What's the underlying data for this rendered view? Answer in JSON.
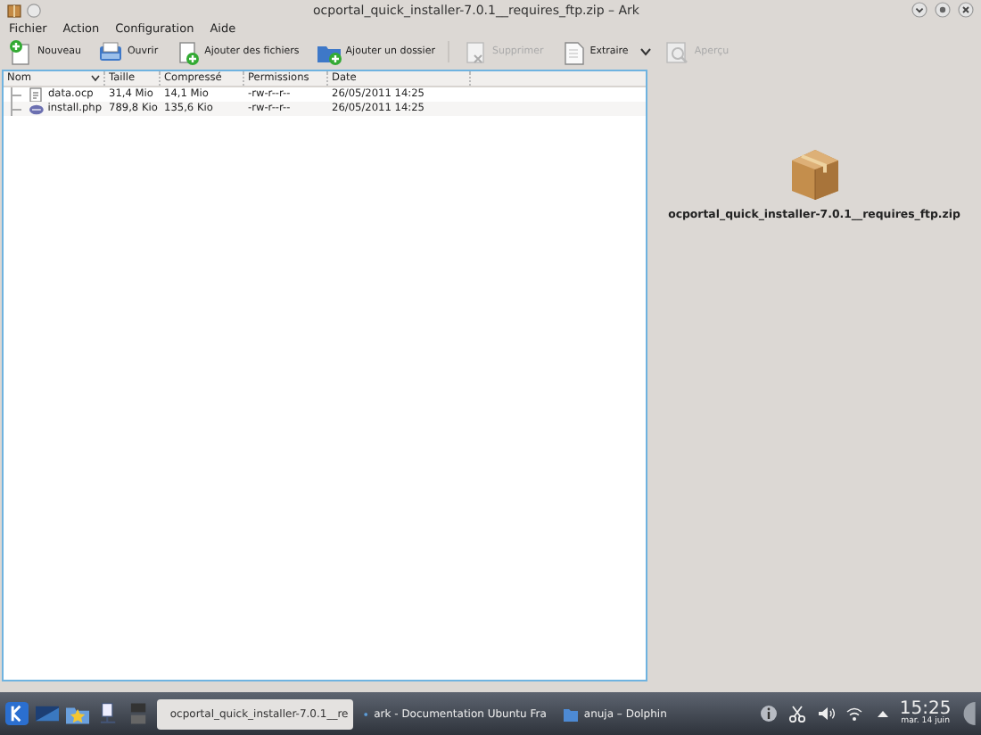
{
  "window": {
    "title": "ocportal_quick_installer-7.0.1__requires_ftp.zip – Ark"
  },
  "menu": [
    {
      "label": "Fichier"
    },
    {
      "label": "Action"
    },
    {
      "label": "Configuration"
    },
    {
      "label": "Aide"
    }
  ],
  "toolbar": [
    {
      "kind": "new",
      "label": "Nouveau",
      "disabled": false
    },
    {
      "kind": "open",
      "label": "Ouvrir",
      "disabled": false
    },
    {
      "kind": "add-files",
      "label": "Ajouter des fichiers",
      "disabled": false
    },
    {
      "kind": "add-folder",
      "label": "Ajouter un dossier",
      "disabled": false
    },
    {
      "kind": "delete",
      "label": "Supprimer",
      "disabled": true
    },
    {
      "kind": "extract",
      "label": "Extraire",
      "disabled": false
    },
    {
      "kind": "preview",
      "label": "Aperçu",
      "disabled": true
    }
  ],
  "file_list": {
    "columns": [
      {
        "label": "Nom",
        "sorted": true
      },
      {
        "label": "Taille",
        "sorted": false
      },
      {
        "label": "Compressé",
        "sorted": false
      },
      {
        "label": "Permissions",
        "sorted": false
      },
      {
        "label": "Date",
        "sorted": false
      }
    ],
    "rows": [
      {
        "kind": "document",
        "cells": [
          "data.ocp",
          "31,4 Mio",
          "14,1 Mio",
          "-rw-r--r--",
          "26/05/2011 14:25"
        ]
      },
      {
        "kind": "php",
        "cells": [
          "install.php",
          "789,8 Kio",
          "135,6 Kio",
          "-rw-r--r--",
          "26/05/2011 14:25"
        ]
      }
    ]
  },
  "info_panel": {
    "file_name": "ocportal_quick_installer-7.0.1__requires_ftp.zip"
  },
  "taskbar": {
    "launchers": [
      {
        "kind": "kde"
      },
      {
        "kind": "desktop"
      },
      {
        "kind": "favorites"
      },
      {
        "kind": "network"
      },
      {
        "kind": "pager"
      }
    ],
    "tasks": [
      {
        "kind": "archive",
        "label": "ocportal_quick_installer-7.0.1__re",
        "selected": true
      },
      {
        "kind": "browser",
        "label": "ark - Documentation Ubuntu Fra",
        "selected": false
      },
      {
        "kind": "folder",
        "label": "anuja – Dolphin",
        "selected": false
      }
    ],
    "tray": [
      {
        "kind": "info"
      },
      {
        "kind": "scissors"
      },
      {
        "kind": "volume"
      },
      {
        "kind": "wifi"
      },
      {
        "kind": "expand"
      }
    ],
    "clock": {
      "time": "15:25",
      "date": "mar. 14 juin"
    }
  }
}
